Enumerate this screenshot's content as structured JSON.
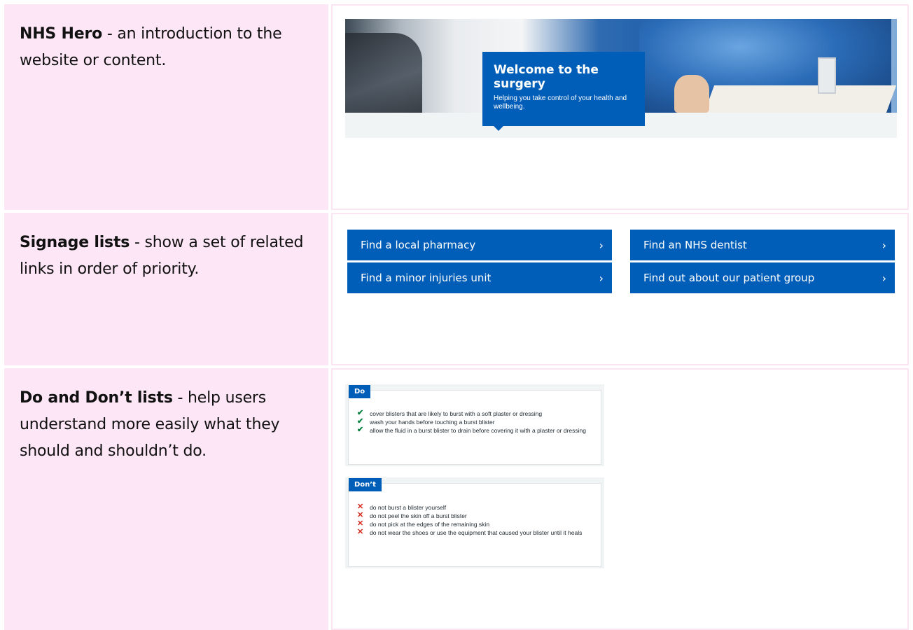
{
  "rows": [
    {
      "title": "NHS Hero",
      "desc": " - an introduction to the website or content."
    },
    {
      "title": "Signage lists",
      "desc": " - show a set of related links in order of priority."
    },
    {
      "title": "Do and Don’t lists",
      "desc": " - help users understand more easily what they should and shouldn’t do."
    }
  ],
  "hero": {
    "heading": "Welcome to the surgery",
    "text": "Helping you take control of your health and wellbeing."
  },
  "signage": [
    {
      "label": "Find a local pharmacy"
    },
    {
      "label": "Find an NHS dentist"
    },
    {
      "label": "Find a minor injuries unit"
    },
    {
      "label": "Find out about our patient group"
    }
  ],
  "chevron": "›",
  "do_list": {
    "tag": "Do",
    "items": [
      "cover blisters that are likely to burst with a soft plaster or dressing",
      "wash your hands before touching a burst blister",
      "allow the fluid in a burst blister to drain before covering it with a plaster or dressing"
    ]
  },
  "dont_list": {
    "tag": "Don’t",
    "items": [
      "do not burst a blister yourself",
      "do not peel the skin off a burst blister",
      "do not pick at the edges of the remaining skin",
      "do not wear the shoes or use the equipment that caused your blister until it heals"
    ]
  },
  "icons": {
    "tick": "check-icon",
    "cross": "cross-icon",
    "chevron": "chevron-right-icon"
  },
  "colors": {
    "nhs_blue": "#005eb8",
    "pink": "#fde6f5",
    "green": "#007f3b",
    "red": "#d5281b"
  }
}
